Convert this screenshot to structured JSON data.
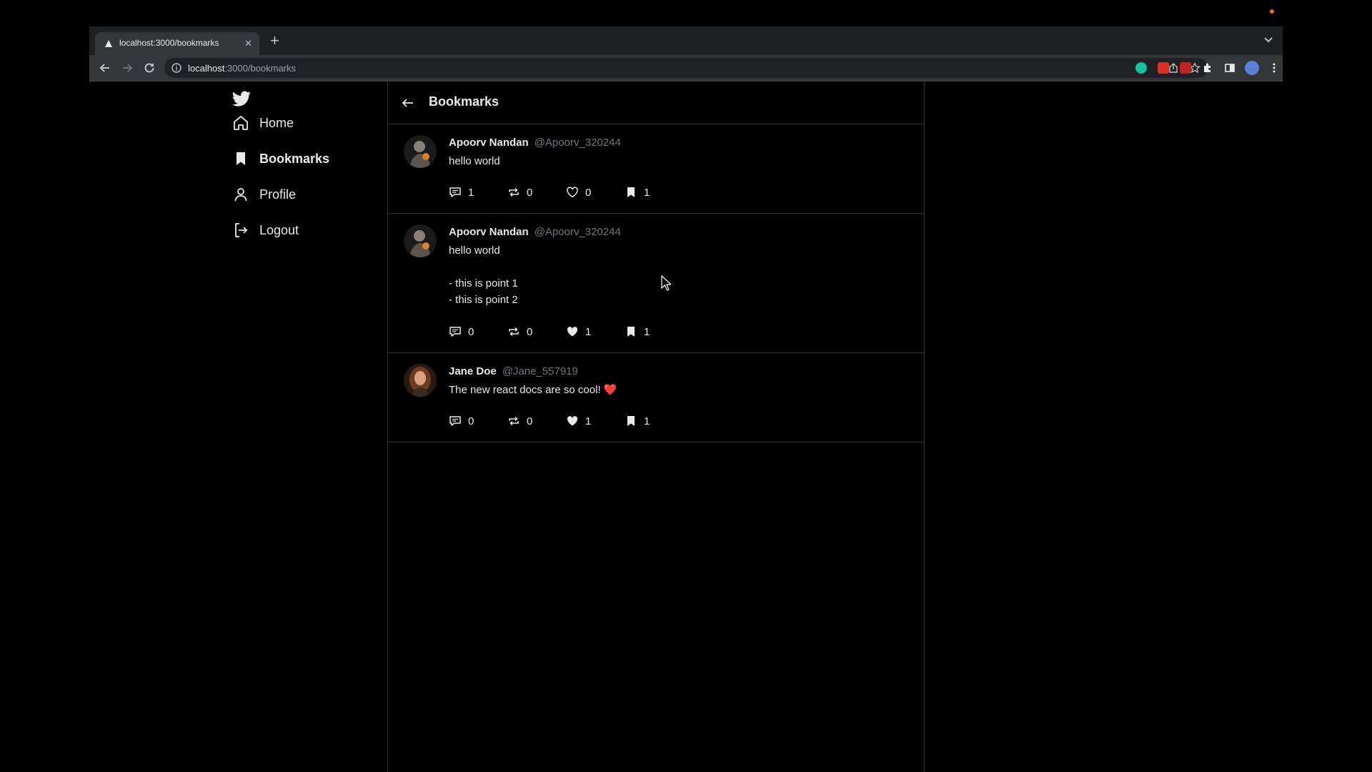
{
  "browser": {
    "tab_title": "localhost:3000/bookmarks",
    "tab_close": "✕",
    "new_tab": "+",
    "url_host": "localhost",
    "url_path": ":3000/bookmarks"
  },
  "sidebar": {
    "items": [
      {
        "label": "Home",
        "icon": "home-icon",
        "active": false
      },
      {
        "label": "Bookmarks",
        "icon": "bookmark-icon",
        "active": true
      },
      {
        "label": "Profile",
        "icon": "user-icon",
        "active": false
      },
      {
        "label": "Logout",
        "icon": "logout-icon",
        "active": false
      }
    ]
  },
  "feed": {
    "title": "Bookmarks",
    "posts": [
      {
        "author": "Apoorv Nandan",
        "handle": "@Apoorv_320244",
        "lines": [
          "hello world"
        ],
        "replies": "1",
        "retweets": "0",
        "likes": "0",
        "bookmarks": "1",
        "liked": false
      },
      {
        "author": "Apoorv Nandan",
        "handle": "@Apoorv_320244",
        "lines": [
          "hello world",
          "",
          "- this is point 1",
          "- this is point 2"
        ],
        "replies": "0",
        "retweets": "0",
        "likes": "1",
        "bookmarks": "1",
        "liked": true
      },
      {
        "author": "Jane Doe",
        "handle": "@Jane_557919",
        "lines": [
          "The new react docs are so cool! ❤️"
        ],
        "replies": "0",
        "retweets": "0",
        "likes": "1",
        "bookmarks": "1",
        "liked": true
      }
    ]
  },
  "colors": {
    "background": "#000000",
    "border": "#2f3336",
    "text": "#e7e9ea",
    "muted": "#71767b",
    "heart_emoji": "#e0245e"
  }
}
